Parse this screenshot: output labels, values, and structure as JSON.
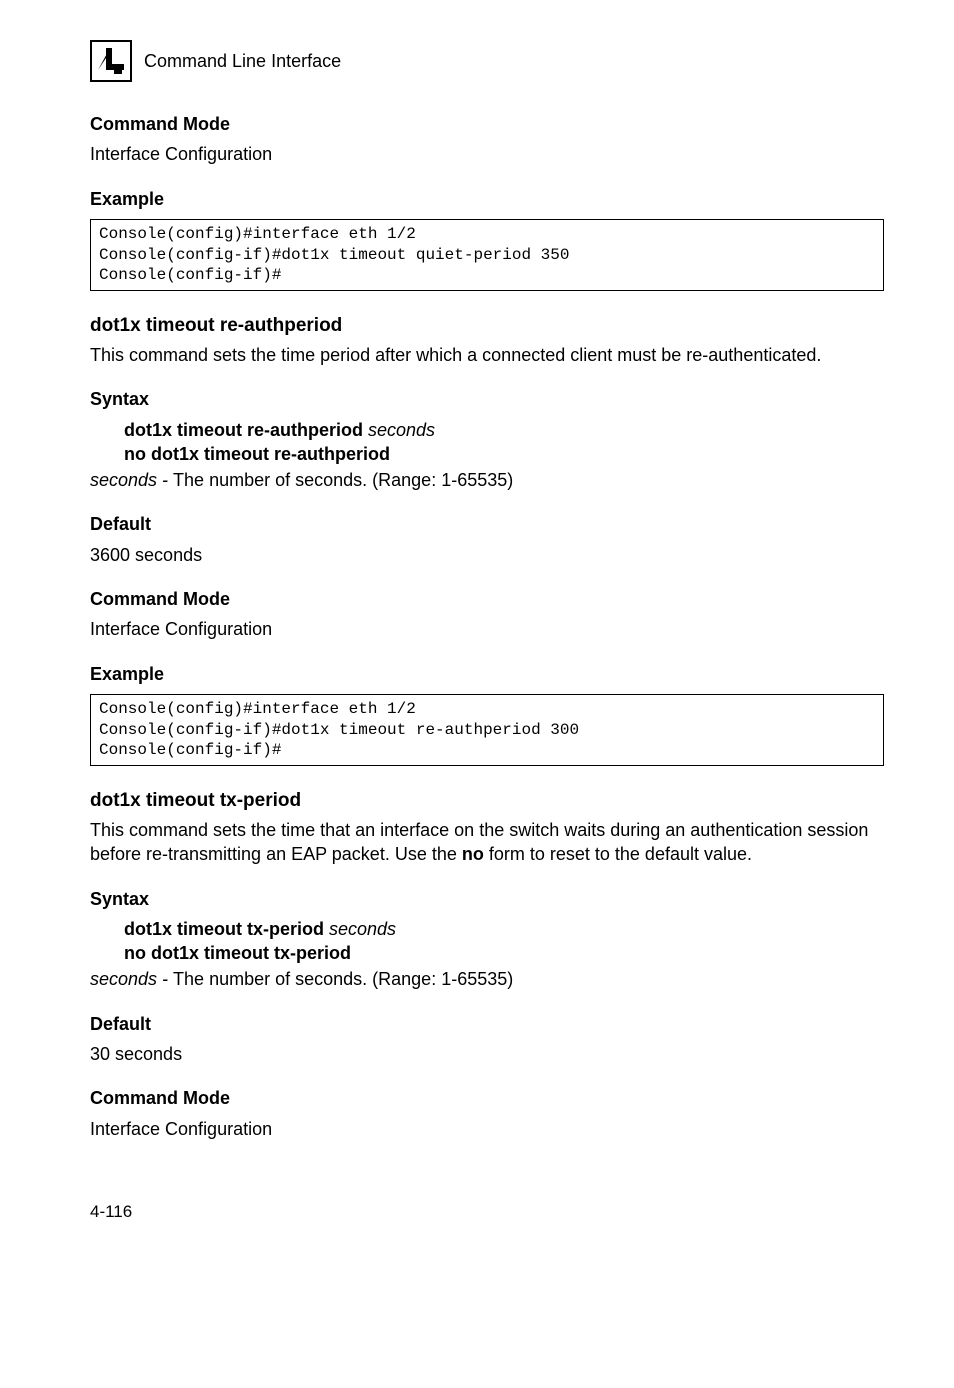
{
  "header": {
    "chapter_number": "4",
    "title": "Command Line Interface"
  },
  "block1": {
    "cmd_mode_label": "Command Mode",
    "cmd_mode_value": "Interface Configuration",
    "example_label": "Example",
    "code": "Console(config)#interface eth 1/2\nConsole(config-if)#dot1x timeout quiet-period 350\nConsole(config-if)#"
  },
  "section2": {
    "title": "dot1x timeout re-authperiod",
    "desc": "This command sets the time period after which a connected client must be re-authenticated.",
    "syntax_label": "Syntax",
    "syntax_line1_bold": "dot1x timeout re-authperiod ",
    "syntax_line1_italic": "seconds",
    "syntax_line2_bold": "no dot1x timeout re-authperiod",
    "param_italic": "seconds - ",
    "param_rest": "The number of seconds. (Range: 1-65535)",
    "default_label": "Default",
    "default_value": "3600 seconds",
    "cmd_mode_label": "Command Mode",
    "cmd_mode_value": "Interface Configuration",
    "example_label": "Example",
    "code": "Console(config)#interface eth 1/2\nConsole(config-if)#dot1x timeout re-authperiod 300\nConsole(config-if)#"
  },
  "section3": {
    "title": "dot1x timeout tx-period",
    "desc_pre": "This command sets the time that an interface on the switch waits during an authentication session before re-transmitting an EAP packet. Use the ",
    "desc_bold": "no",
    "desc_post": " form to reset to the default value.",
    "syntax_label": "Syntax",
    "syntax_line1_bold": "dot1x timeout tx-period ",
    "syntax_line1_italic": "seconds",
    "syntax_line2_bold": "no dot1x timeout tx-period",
    "param_italic": "seconds - ",
    "param_rest": "The number of seconds. (Range: 1-65535)",
    "default_label": "Default",
    "default_value": "30 seconds",
    "cmd_mode_label": "Command Mode",
    "cmd_mode_value": "Interface Configuration"
  },
  "footer": {
    "page": "4-116"
  }
}
